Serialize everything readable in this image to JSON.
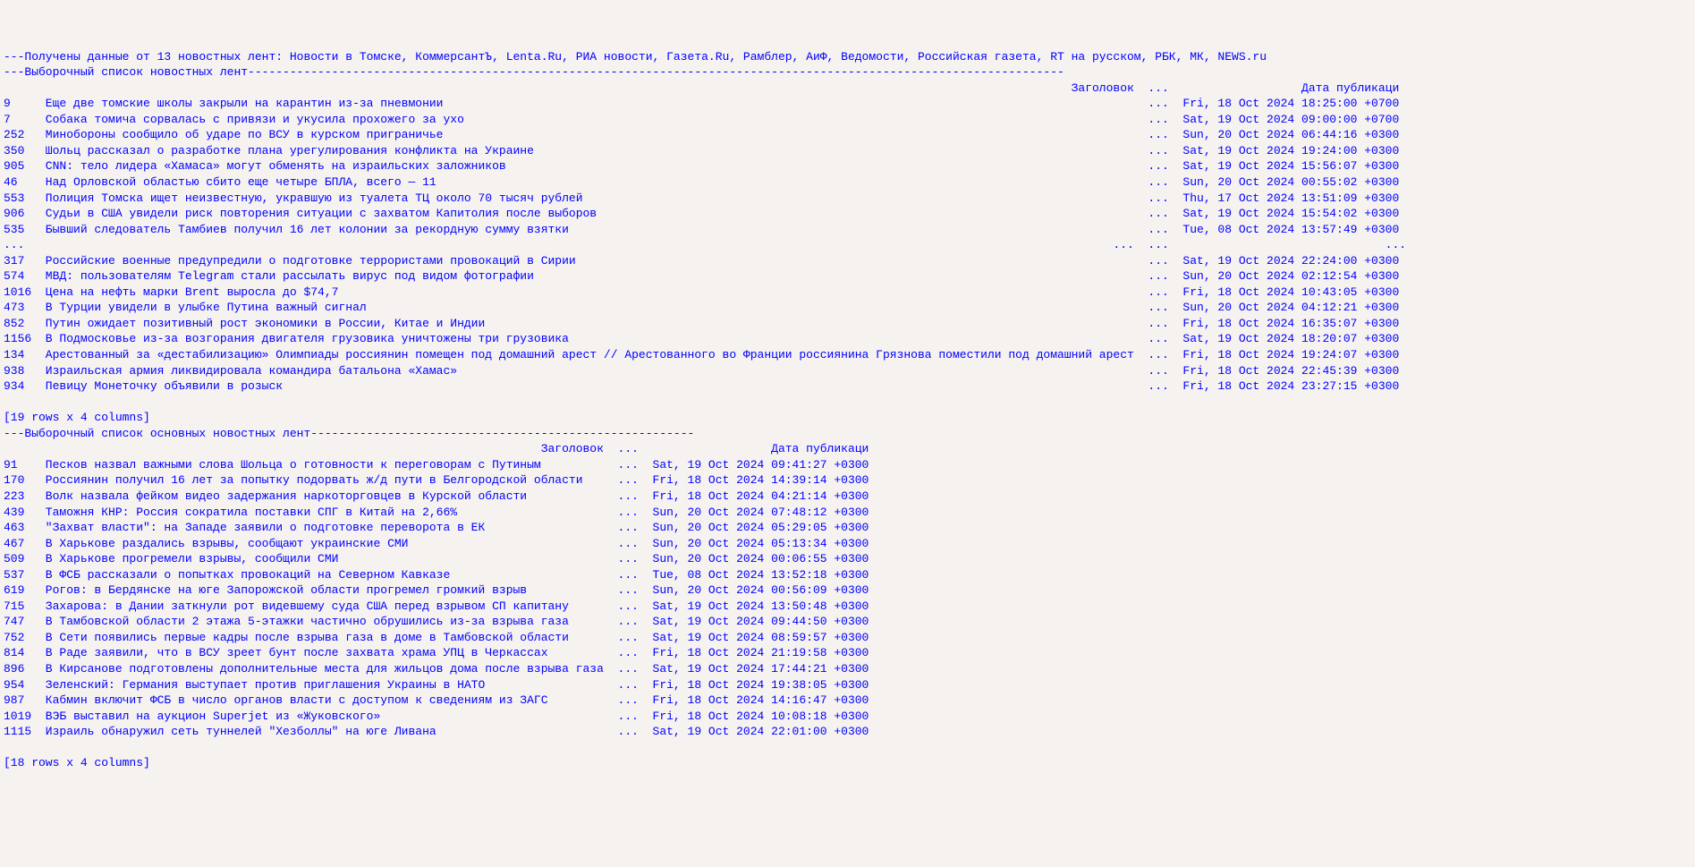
{
  "header": {
    "sourcesLine": "---Получены данные от 13 новостных лент: Новости в Томске, КоммерсантЪ, Lenta.Ru, РИА новости, Газета.Ru, Рамблер, АиФ, Ведомости, Российская газета, RT на русском, РБК, МК, NEWS.ru",
    "section1": "---Выборочный список новостных лент---------------------------------------------------------------------------------------------------------------------",
    "section2": "---Выборочный список основных новостных лент-------------------------------------------------------"
  },
  "t1": {
    "colTitle": "Заголовок",
    "colDate": "Дата публикаци",
    "shape": "[19 rows x 4 columns]",
    "data": [
      {
        "id": "9",
        "title": "Еще две томские школы закрыли на карантин из-за пневмонии",
        "date": "Fri, 18 Oct 2024 18:25:00 +0700"
      },
      {
        "id": "7",
        "title": "Собака томича сорвалась с привязи и укусила прохожего за ухо",
        "date": "Sat, 19 Oct 2024 09:00:00 +0700"
      },
      {
        "id": "252",
        "title": "Минобороны сообщило об ударе по ВСУ в курском приграничье",
        "date": "Sun, 20 Oct 2024 06:44:16 +0300"
      },
      {
        "id": "350",
        "title": "Шольц рассказал о разработке плана урегулирования конфликта на Украине",
        "date": "Sat, 19 Oct 2024 19:24:00 +0300"
      },
      {
        "id": "905",
        "title": "CNN: тело лидера «Хамаса» могут обменять на израильских заложников",
        "date": "Sat, 19 Oct 2024 15:56:07 +0300"
      },
      {
        "id": "46",
        "title": "Над Орловской областью сбито еще четыре БПЛА, всего — 11",
        "date": "Sun, 20 Oct 2024 00:55:02 +0300"
      },
      {
        "id": "553",
        "title": "Полиция Томска ищет неизвестную, укравшую из туалета ТЦ около 70 тысяч рублей",
        "date": "Thu, 17 Oct 2024 13:51:09 +0300"
      },
      {
        "id": "906",
        "title": "Судьи в США увидели риск повторения ситуации с захватом Капитолия после выборов",
        "date": "Sat, 19 Oct 2024 15:54:02 +0300"
      },
      {
        "id": "535",
        "title": "Бывший следователь Тамбиев получил 16 лет колонии за рекордную сумму взятки",
        "date": "Tue, 08 Oct 2024 13:57:49 +0300"
      },
      {
        "id": "...",
        "title": "...",
        "date": "..."
      },
      {
        "id": "317",
        "title": "Российские военные предупредили о подготовке террористами провокаций в Сирии",
        "date": "Sat, 19 Oct 2024 22:24:00 +0300"
      },
      {
        "id": "574",
        "title": "МВД: пользователям Telegram стали рассылать вирус под видом фотографии",
        "date": "Sun, 20 Oct 2024 02:12:54 +0300"
      },
      {
        "id": "1016",
        "title": "Цена на нефть марки Brent выросла до $74,7",
        "date": "Fri, 18 Oct 2024 10:43:05 +0300"
      },
      {
        "id": "473",
        "title": "В Турции увидели в улыбке Путина важный сигнал",
        "date": "Sun, 20 Oct 2024 04:12:21 +0300"
      },
      {
        "id": "852",
        "title": "Путин ожидает позитивный рост экономики в России, Китае и Индии",
        "date": "Fri, 18 Oct 2024 16:35:07 +0300"
      },
      {
        "id": "1156",
        "title": "В Подмосковье из-за возгорания двигателя грузовика уничтожены три грузовика",
        "date": "Sat, 19 Oct 2024 18:20:07 +0300"
      },
      {
        "id": "134",
        "title": "Арестованный за «дестабилизацию» Олимпиады россиянин помещен под домашний арест // Арестованного во Франции россиянина Грязнова поместили под домашний арест",
        "date": "Fri, 18 Oct 2024 19:24:07 +0300"
      },
      {
        "id": "938",
        "title": "Израильская армия ликвидировала командира батальона «Хамас»",
        "date": "Fri, 18 Oct 2024 22:45:39 +0300"
      },
      {
        "id": "934",
        "title": "Певицу Монеточку объявили в розыск",
        "date": "Fri, 18 Oct 2024 23:27:15 +0300"
      }
    ]
  },
  "t2": {
    "colTitle": "Заголовок",
    "colDate": "Дата публикаци",
    "shape": "[18 rows x 4 columns]",
    "data": [
      {
        "id": "91",
        "title": "Песков назвал важными слова Шольца о готовности к переговорам с Путиным",
        "date": "Sat, 19 Oct 2024 09:41:27 +0300"
      },
      {
        "id": "170",
        "title": "Россиянин получил 16 лет за попытку подорвать ж/д пути в Белгородской области",
        "date": "Fri, 18 Oct 2024 14:39:14 +0300"
      },
      {
        "id": "223",
        "title": "Волк назвала фейком видео задержания наркоторговцев в Курской области",
        "date": "Fri, 18 Oct 2024 04:21:14 +0300"
      },
      {
        "id": "439",
        "title": "Таможня КНР: Россия сократила поставки СПГ в Китай на 2,66%",
        "date": "Sun, 20 Oct 2024 07:48:12 +0300"
      },
      {
        "id": "463",
        "title": "\"Захват власти\": на Западе заявили о подготовке переворота в ЕК",
        "date": "Sun, 20 Oct 2024 05:29:05 +0300"
      },
      {
        "id": "467",
        "title": "В Харькове раздались взрывы, сообщают украинские СМИ",
        "date": "Sun, 20 Oct 2024 05:13:34 +0300"
      },
      {
        "id": "509",
        "title": "В Харькове прогремели взрывы, сообщили СМИ",
        "date": "Sun, 20 Oct 2024 00:06:55 +0300"
      },
      {
        "id": "537",
        "title": "В ФСБ рассказали о попытках провокаций на Северном Кавказе",
        "date": "Tue, 08 Oct 2024 13:52:18 +0300"
      },
      {
        "id": "619",
        "title": "Рогов: в Бердянске на юге Запорожской области прогремел громкий взрыв",
        "date": "Sun, 20 Oct 2024 00:56:09 +0300"
      },
      {
        "id": "715",
        "title": "Захарова: в Дании заткнули рот видевшему суда США перед взрывом СП капитану",
        "date": "Sat, 19 Oct 2024 13:50:48 +0300"
      },
      {
        "id": "747",
        "title": "В Тамбовской области 2 этажа 5-этажки частично обрушились из-за взрыва газа",
        "date": "Sat, 19 Oct 2024 09:44:50 +0300"
      },
      {
        "id": "752",
        "title": "В Сети появились первые кадры после взрыва газа в доме в Тамбовской области",
        "date": "Sat, 19 Oct 2024 08:59:57 +0300"
      },
      {
        "id": "814",
        "title": "В Раде заявили, что в ВСУ зреет бунт после захвата храма УПЦ в Черкассах",
        "date": "Fri, 18 Oct 2024 21:19:58 +0300"
      },
      {
        "id": "896",
        "title": "В Кирсанове подготовлены дополнительные места для жильцов дома после взрыва газа",
        "date": "Sat, 19 Oct 2024 17:44:21 +0300"
      },
      {
        "id": "954",
        "title": "Зеленский: Германия выступает против приглашения Украины в НАТО",
        "date": "Fri, 18 Oct 2024 19:38:05 +0300"
      },
      {
        "id": "987",
        "title": "Кабмин включит ФСБ в число органов власти с доступом к сведениям из ЗАГС",
        "date": "Fri, 18 Oct 2024 14:16:47 +0300"
      },
      {
        "id": "1019",
        "title": "ВЭБ выставил на аукцион Superjet из «Жуковского»",
        "date": "Fri, 18 Oct 2024 10:08:18 +0300"
      },
      {
        "id": "1115",
        "title": "Израиль обнаружил сеть туннелей \"Хезболлы\" на юге Ливана",
        "date": "Sat, 19 Oct 2024 22:01:00 +0300"
      }
    ]
  }
}
